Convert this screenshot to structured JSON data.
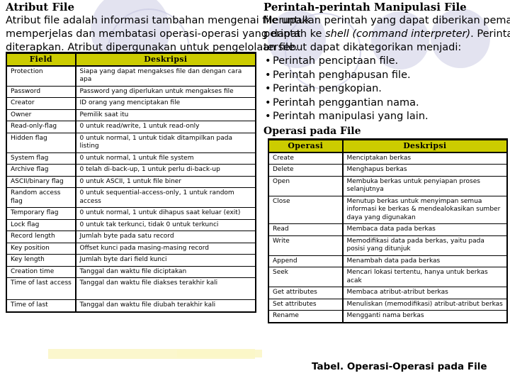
{
  "slide": {
    "left_column": {
      "title": "Atribut File",
      "paragraph_lines": [
        "Atribut file adalah informasi tambahan mengenai file untuk",
        "memperjelas dan membatasi operasi-operasi yang dapat",
        "diterapkan. Atribut dipergunakan untuk pengelolaan file."
      ]
    },
    "right_column": {
      "title": "Perintah-perintah Manipulasi File",
      "paragraph_lines": [
        "Merupakan perintah yang dapat diberikan pemakai dalam bentuk",
        "perintah ke ",
        "shell (command interpreter)",
        ". Perintah-perintah",
        "tersebut dapat dikategorikan menjadi:"
      ],
      "bullets": [
        "Perintah penciptaan file.",
        "Perintah penghapusan file.",
        "Perintah pengkopian.",
        "Perintah penggantian nama.",
        "Perintah manipulasi yang lain."
      ],
      "sub_title": "Operasi pada File"
    },
    "attribute_table": {
      "headers": [
        "Field",
        "Deskripsi"
      ],
      "rows": [
        [
          "Protection",
          "Siapa yang dapat mengakses file dan dengan cara apa"
        ],
        [
          "Password",
          "Password yang diperlukan untuk mengakses file"
        ],
        [
          "Creator",
          "ID orang yang menciptakan file"
        ],
        [
          "Owner",
          "Pemilik saat itu"
        ],
        [
          "Read-only-flag",
          "0 untuk read/write, 1 untuk read-only"
        ],
        [
          "Hidden flag",
          "0 untuk normal, 1 untuk tidak ditampilkan pada listing"
        ],
        [
          "System flag",
          "0 untuk normal, 1 untuk file system"
        ],
        [
          "Archive flag",
          "0 telah di-back-up, 1 untuk perlu di-back-up"
        ],
        [
          "ASCII/binary flag",
          "0 untuk ASCII, 1 untuk file biner"
        ],
        [
          "Random access flag",
          "0 untuk sequential-access-only, 1 untuk random access"
        ],
        [
          "Temporary flag",
          "0 untuk normal, 1 untuk dihapus saat keluar (exit)"
        ],
        [
          "Lock flag",
          "0 untuk tak terkunci, tidak 0 untuk terkunci"
        ],
        [
          "Record length",
          "Jumlah byte pada satu record"
        ],
        [
          "Key position",
          "Offset kunci pada masing-masing record"
        ],
        [
          "Key length",
          "Jumlah  byte dari field kunci"
        ],
        [
          "Creation time",
          "Tanggal dan waktu file diciptakan"
        ],
        [
          "Time of last access",
          "Tanggal dan waktu file diakses terakhir kali"
        ],
        [
          "Time of last",
          "Tanggal dan waktu file diubah terakhir kali"
        ]
      ]
    },
    "operation_table": {
      "headers": [
        "Operasi",
        "Deskripsi"
      ],
      "rows": [
        [
          "Create",
          "Menciptakan berkas"
        ],
        [
          "Delete",
          "Menghapus berkas"
        ],
        [
          "Open",
          "Membuka berkas untuk penyiapan proses selanjutnya"
        ],
        [
          "Close",
          "Menutup berkas untuk menyimpan semua informasi ke berkas & mendealokasikan sumber daya yang digunakan"
        ],
        [
          "Read",
          "Membaca data pada berkas"
        ],
        [
          "Write",
          "Memodifikasi data pada berkas, yaitu pada posisi yang ditunjuk"
        ],
        [
          "Append",
          "Menambah data pada berkas"
        ],
        [
          "Seek",
          "Mencari lokasi tertentu, hanya untuk berkas acak"
        ],
        [
          "Get attributes",
          "Membaca atribut-atribut berkas"
        ],
        [
          "Set attributes",
          "Menuliskan (memodifikasi) atribut-atribut berkas"
        ],
        [
          "Rename",
          "Mengganti nama berkas"
        ]
      ],
      "caption": "Tabel. Operasi-Operasi pada File"
    },
    "colors": {
      "table_header": "#cccc00",
      "decoration": "#ccccE4",
      "highlight_band": "#fbf6c8",
      "text": "#000000"
    }
  }
}
